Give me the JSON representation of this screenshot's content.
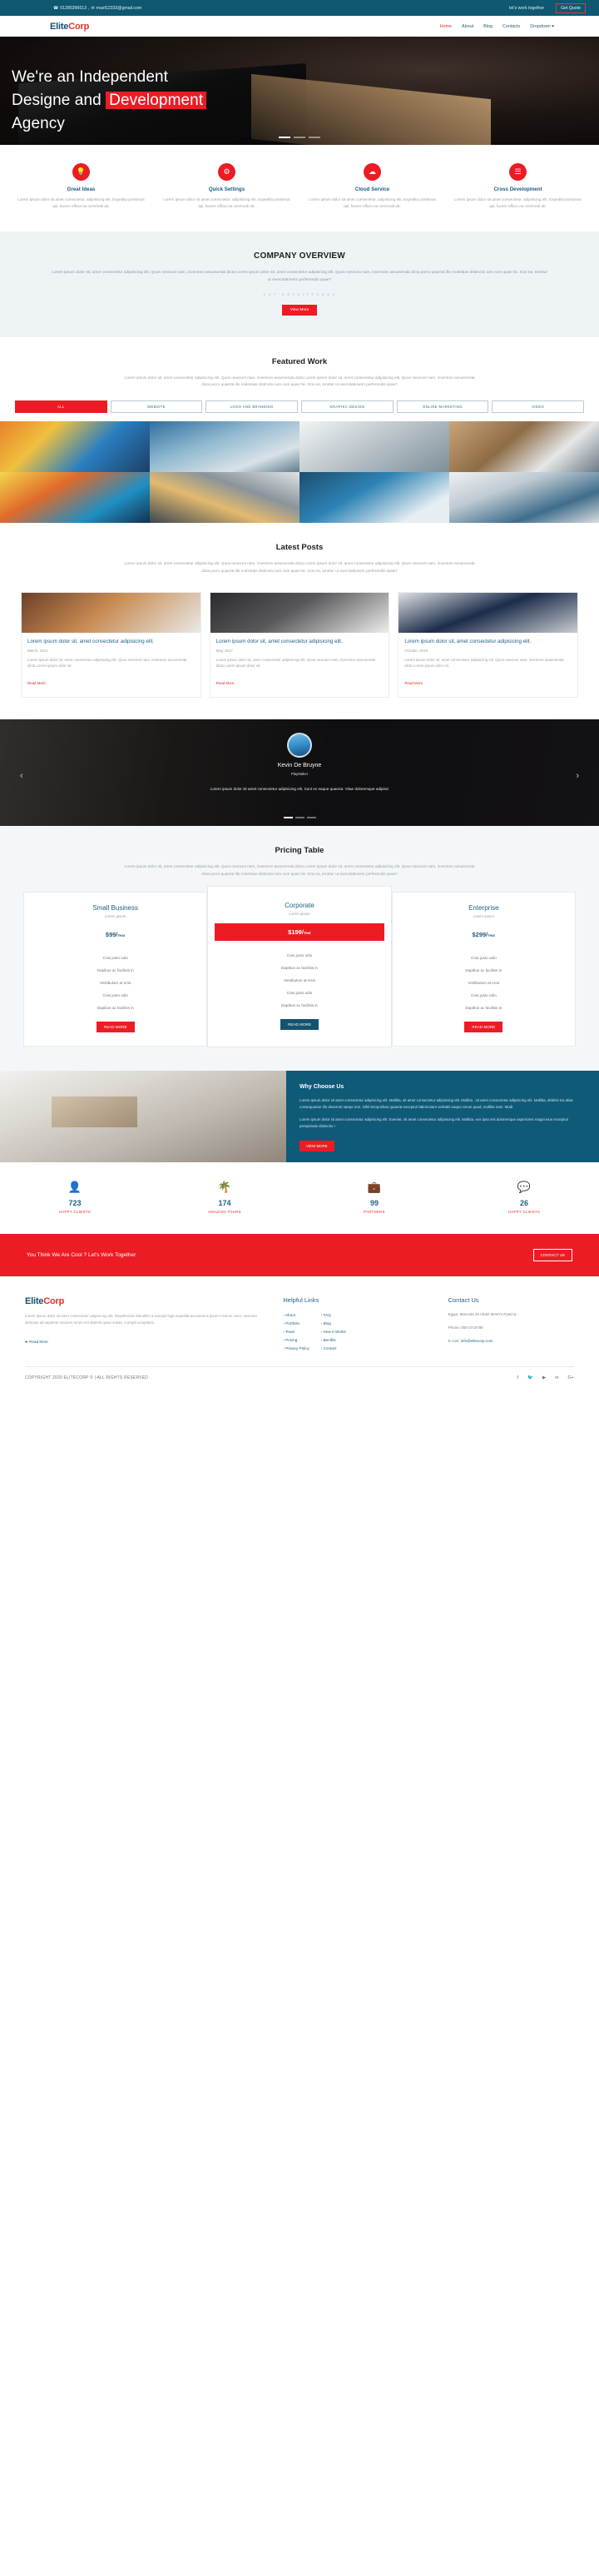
{
  "topbar": {
    "phone": "01285396613",
    "separator": ",",
    "email": "masf12333@gmail.com",
    "tagline": "let's work together",
    "quote_label": "Get Quote",
    "phone_icon": "phone-icon",
    "email_icon": "envelope-icon"
  },
  "brand": {
    "part1": "Elite",
    "part2": "Corp"
  },
  "nav": {
    "items": [
      {
        "label": "Home",
        "active": true
      },
      {
        "label": "About",
        "active": false
      },
      {
        "label": "Blog",
        "active": false
      },
      {
        "label": "Contacts",
        "active": false
      },
      {
        "label": "Dropdown ▾",
        "active": false
      }
    ]
  },
  "hero": {
    "line1": "We're an Independent",
    "line2a": "Designe and ",
    "line2b": "Development",
    "line3": "Agency"
  },
  "services": [
    {
      "icon": "lightbulb-icon",
      "glyph": "Ὂ1",
      "title": "Great Ideas",
      "text": "Lorem ipsum dolor sit amet consectetur, adipisicing elit. Expedita possimus qui, facere officia ea commodi ab."
    },
    {
      "icon": "gears-icon",
      "glyph": "⚙",
      "title": "Quick Settings",
      "text": "Lorem ipsum dolor sit amet consectetur, adipisicing elit. Expedita possimus qui, facere officia ea commodi ab."
    },
    {
      "icon": "cloud-icon",
      "glyph": "☁",
      "title": "Cloud Service",
      "text": "Lorem ipsum dolor sit amet consectetur, adipisicing elit. Expedita possimus qui, facere officia ea commodi ab."
    },
    {
      "icon": "code-icon",
      "glyph": "≡",
      "title": "Cross Development",
      "text": "Lorem ipsum dolor sit amet consectetur, adipisicing elit. Expedita possimus qui, facere officia ea commodi ab."
    }
  ],
  "overview": {
    "title": "COMPANY OVERVIEW",
    "text": "Lorem ipsum dolor sit, amet consectetur adipisicing elit. Quos nesciunt nam, inventore assumenda dicta Lorem ipsum dolor sit, amet consectetur adipisicing elit. Quos nesciunt nam, inventore assumenda dicta porro quaerat illo molestias distinctio iure cum quae hic. Eos ea, tenetur ut exercitationem perferendis quae?",
    "subtitle": "L e t ' s   S t a r t   T o d a y",
    "button": "View More"
  },
  "featured": {
    "title": "Featured Work",
    "lead": "Lorem ipsum dolor sit, amet consectetur adipisicing elit. Quos nesciunt nam, inventore assumenda dicta Lorem ipsum dolor sit, amet consectetur adipisicing elit. Quos nesciunt nam, inventore assumenda dicta porro quaerat illo molestias distinctio iure cum quae hic. Eos ea, tenetur ut exercitationem perferendis quae?",
    "filters": [
      {
        "label": "ALL",
        "active": true
      },
      {
        "label": "WEBSITE",
        "active": false
      },
      {
        "label": "LOGO AND BRANDING",
        "active": false
      },
      {
        "label": "GRAPHIC DESIGN",
        "active": false
      },
      {
        "label": "ONLINE MARKETING",
        "active": false
      },
      {
        "label": "VIDEO",
        "active": false
      }
    ]
  },
  "posts": {
    "title": "Latest Posts",
    "lead": "Lorem ipsum dolor sit, amet consectetur adipisicing elit. Quos nesciunt nam, inventore assumenda dicta Lorem ipsum dolor sit, amet consectetur adipisicing elit. Quos nesciunt nam, inventore assumenda dicta porro quaerat illo molestias distinctio iure cum quae hic. Eos ea, tenetur ut exercitationem perferendis quae?",
    "items": [
      {
        "title": "Lorem ipsum dolor sit, amet consectetur adipisicing elit.",
        "date": "March, 2014",
        "text": "Lorem ipsum dolor sit, amet consectetur adipisicing elit. Quos nesciunt nam, inventore assumenda dicta Lorem ipsum dolor sit.",
        "more": "Read More"
      },
      {
        "title": "Lorem ipsum dolor sit, amet consectetur adipisicing elit.",
        "date": "May, 2017",
        "text": "Lorem ipsum dolor sit, amet consectetur adipisicing elit. Quos nesciunt nam, inventore assumenda dicta Lorem ipsum dolor sit.",
        "more": "Read More"
      },
      {
        "title": "Lorem ipsum dolor sit, amet consectetur adipisicing elit.",
        "date": "October, 2019",
        "text": "Lorem ipsum dolor sit, amet consectetur adipisicing elit. Quos nesciunt nam, inventore assumenda dicta Lorem ipsum dolor sit.",
        "more": "Read More"
      }
    ]
  },
  "testimonial": {
    "name": "Kevin De Bruyne",
    "role": "PlayMaker",
    "quote": "Lorem ipsum dolor sit amet consectetur adipisicing elit. Sunt ex eaque quaerat. Vitae doloremque adipisci",
    "prev_icon": "chevron-left-icon",
    "next_icon": "chevron-right-icon"
  },
  "pricing": {
    "title": "Pricing Table",
    "lead": "Lorem ipsum dolor sit, amet consectetur adipisicing elit. Quos nesciunt nam, inventore assumenda dicta Lorem ipsum dolor sit, amet consectetur adipisicing elit. Quos nesciunt nam, inventore assumenda dicta porro quaerat illo molestias distinctio iure cum quae hic. Eos ea, tenetur ut exercitationem perferendis quae?",
    "plans": [
      {
        "name": "Small Business",
        "sub": "Lorem ipsum",
        "price": "$99/",
        "period": "Year",
        "features": [
          "Cras justo odio",
          "Dapibus ac facilisis in",
          "Vestibulum at eros",
          "Cras justo odio",
          "Dapibus ac facilisis in"
        ],
        "button": "READ MORE",
        "featured": false
      },
      {
        "name": "Corporate",
        "sub": "Lorem ipsum",
        "price": "$199/",
        "period": "Year",
        "features": [
          "Cras justo odio",
          "Dapibus ac facilisis in",
          "Vestibulum at eros",
          "Cras justo odio",
          "Dapibus ac facilisis in"
        ],
        "button": "READ MORE",
        "featured": true
      },
      {
        "name": "Enterprise",
        "sub": "Lorem ipsum",
        "price": "$299/",
        "period": "Year",
        "features": [
          "Cras justo odio",
          "Dapibus ac facilisis in",
          "Vestibulum at eros",
          "Cras justo odio",
          "Dapibus ac facilisis in"
        ],
        "button": "READ MORE",
        "featured": false
      }
    ]
  },
  "why": {
    "title": "Why Choose Us",
    "p1": "Lorem ipsum dolor sit amet consectetur adipisicing elit. Mollitia, sit amet consectetur adipisicing elit. Mollitia , sit amet consectetur adipisicing elit. Mollitia, debitis! Ea alias consequuntur illo deserunt saepe non. Nihil temporibus quaerat excepturi laboriosam veritatis eaque rerum quod, mollitia nam. Modi.",
    "p2": "Lorem ipsum dolor sit amet consectetur adipisicing elit. Eveniet, sit amet consectetur adipisicing elit. Mollitia, eos ipsa nisi doloremque asperiores magni eius excepturi perspiciatis distinctio !",
    "button": "VIEW MORE"
  },
  "counters": [
    {
      "icon": "user-icon",
      "glyph": "👤",
      "number": "723",
      "label": "HAPPY CLIENTS"
    },
    {
      "icon": "palm-tree-icon",
      "glyph": "🌴",
      "number": "174",
      "label": "AMAZING TOURS"
    },
    {
      "icon": "briefcase-icon",
      "glyph": "💼",
      "number": "99",
      "label": "PARTNERS"
    },
    {
      "icon": "comment-icon",
      "glyph": "💬",
      "number": "26",
      "label": "HAPPY CLIENTS"
    }
  ],
  "cta": {
    "text": "You Think We Are Cool ? Let's Work Together",
    "button": "CONTACT US"
  },
  "footer": {
    "about_text": "Lorem ipsum dolor sit amet consectetur adipisicing elit. Repellendus blanditiis a suscipit fugit expedita accusamus ipsum! Harum iusto, nesciunt delectus ad sapiente maiores rerum est deleniti quasi soluta, corrupti voluptates.",
    "read_more": "Read More",
    "read_more_icon": "arrow-circle-right-icon",
    "links_title": "Helpful Links",
    "links_col1": [
      "About",
      "Portfolio",
      "Team",
      "Pricing",
      "Privacy Policy"
    ],
    "links_col2": [
      "FAQ",
      "Blog",
      "How It Works",
      "Benifits",
      "Contact"
    ],
    "contact_title": "Contact Us",
    "address": "Egypt, Manzala 26 Abdel Meni'm Ryad st.",
    "phone_label": "Phone: ",
    "phone": "050-3719788",
    "email_label": "E-mail: ",
    "email": "info@elitecorp.com",
    "copyright": "COPYRIGHT 2020 ELITECORP © | ALL RIGHTS RESERVED .",
    "social": [
      {
        "name": "facebook-icon",
        "glyph": "f"
      },
      {
        "name": "twitter-icon",
        "glyph": "🐦"
      },
      {
        "name": "youtube-icon",
        "glyph": "▶"
      },
      {
        "name": "linkedin-icon",
        "glyph": "in"
      },
      {
        "name": "googleplus-icon",
        "glyph": "G+"
      }
    ]
  },
  "colors": {
    "brand_blue": "#15506b",
    "brand_red": "#ec1c24",
    "topbar": "#0e5871"
  }
}
